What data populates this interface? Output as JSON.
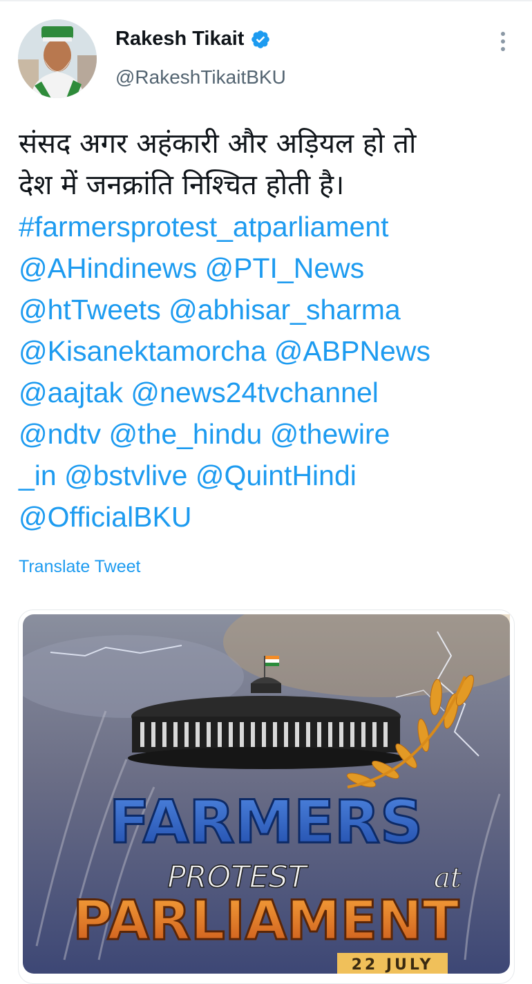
{
  "tweet": {
    "author_name": "Rakesh Tikait",
    "handle": "@RakeshTikaitBKU",
    "text_lines": [
      "संसद अगर अहंकारी और अड़ियल हो तो",
      "देश में जनक्रांति निश्चित होती है।"
    ],
    "link_lines": [
      "#farmersprotest_atparliament",
      "@AHindinews @PTI_News",
      "@htTweets @abhisar_sharma",
      "@Kisanektamorcha @ABPNews",
      "@aajtak @news24tvchannel",
      "@ndtv @the_hindu @thewire",
      "_in @bstvlive @QuintHindi",
      "@OfficialBKU"
    ],
    "translate_label": "Translate Tweet"
  },
  "poster": {
    "title_line1": "FARMERS",
    "title_line2": "PROTEST",
    "title_at": "at",
    "title_line3": "PARLIAMENT",
    "date": "22 JULY"
  },
  "icons": {
    "verified": "verified-badge-icon",
    "more": "more-vertical-icon"
  },
  "colors": {
    "link": "#1d9bf0",
    "text": "#0f1419",
    "muted": "#536471",
    "poster_title": "#2f63c7",
    "poster_orange": "#e07a1a"
  }
}
